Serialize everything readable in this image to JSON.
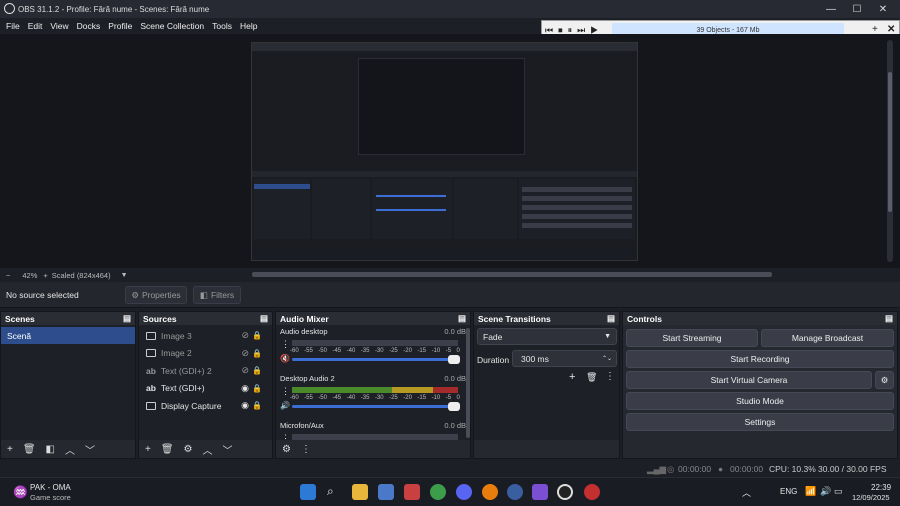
{
  "title": "OBS 31.1.2 - Profile: Fără nume - Scenes: Fără nume",
  "window_controls": {
    "minimize": "—",
    "maximize": "☐",
    "close": "✕"
  },
  "menu": [
    "File",
    "Edit",
    "View",
    "Docks",
    "Profile",
    "Scene Collection",
    "Tools",
    "Help"
  ],
  "overlay": {
    "objects": "39 Objects - 167 Mb",
    "plus": "+",
    "close": "✕"
  },
  "zoom": {
    "percent": "42%",
    "scaled": "Scaled (824x464)",
    "minus": "−",
    "plus": "+"
  },
  "source_bar": {
    "no_source": "No source selected",
    "properties": "Properties",
    "filters": "Filters"
  },
  "scenes": {
    "title": "Scenes",
    "items": [
      "Scenă"
    ]
  },
  "sources": {
    "title": "Sources",
    "items": [
      {
        "name": "Image 3",
        "dim": true
      },
      {
        "name": "Image 2",
        "dim": true
      },
      {
        "name": "Text (GDI+) 2",
        "dim": true
      },
      {
        "name": "Text (GDI+)",
        "dim": false
      },
      {
        "name": "Display Capture",
        "dim": false
      }
    ]
  },
  "mixer": {
    "title": "Audio Mixer",
    "tracks": [
      {
        "name": "Audio desktop",
        "db": "0.0 dB",
        "level": 0,
        "muted": true
      },
      {
        "name": "Desktop Audio 2",
        "db": "0.0 dB",
        "level": 0.87,
        "muted": false
      },
      {
        "name": "Microfon/Aux",
        "db": "0.0 dB",
        "level": 0,
        "muted": false
      }
    ],
    "ticks": [
      "-60",
      "-55",
      "-50",
      "-45",
      "-40",
      "-35",
      "-30",
      "-25",
      "-20",
      "-15",
      "-10",
      "-5",
      "0"
    ]
  },
  "transitions": {
    "title": "Scene Transitions",
    "selected": "Fade",
    "duration_label": "Duration",
    "duration": "300 ms"
  },
  "controls": {
    "title": "Controls",
    "start_streaming": "Start Streaming",
    "manage_broadcast": "Manage Broadcast",
    "start_recording": "Start Recording",
    "start_virtual_camera": "Start Virtual Camera",
    "studio_mode": "Studio Mode",
    "settings": "Settings"
  },
  "status": {
    "stream_time": "00:00:00",
    "rec_time": "00:00:00",
    "cpu": "CPU: 10.3%",
    "fps": "30.00 / 30.00 FPS"
  },
  "taskbar": {
    "app": "PAK - OMA",
    "subtitle": "Game score",
    "lang": "ENG",
    "time": "22:39",
    "date": "12/09/2025"
  },
  "preview_text": {
    "no_source": "No source selected",
    "audio_mixer": "Audio Mixer",
    "scene_transitions": "Scene Transitions",
    "controls": "Controls",
    "sources": "Sources",
    "scenes": "Scenes"
  },
  "colors": {
    "accent": "#2d4d8c",
    "slider": "#3b6fd6",
    "meter_green": "#4a8a2a",
    "meter_yellow": "#b59a24",
    "meter_red": "#a52a2a"
  }
}
